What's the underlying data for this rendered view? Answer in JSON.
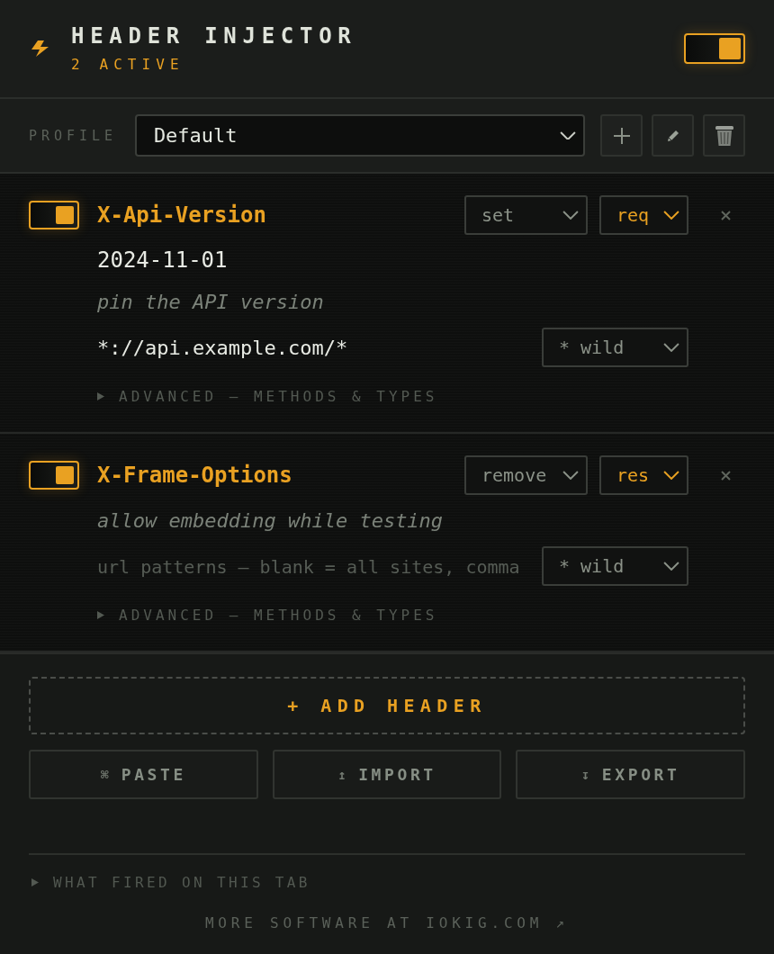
{
  "app": {
    "title": "HEADER INJECTOR",
    "status": "2 ACTIVE",
    "enabled": true
  },
  "profile": {
    "label": "PROFILE",
    "value": "Default"
  },
  "headers": [
    {
      "enabled": true,
      "name": "X-Api-Version",
      "operation": "set",
      "direction": "req",
      "value": "2024-11-01",
      "comment": "pin the API version",
      "url_patterns": {
        "value": "*://api.example.com/*"
      },
      "match_mode": "* wild",
      "advanced": {
        "label": "ADVANCED — METHODS & TYPES",
        "expanded": false
      }
    },
    {
      "enabled": true,
      "name": "X-Frame-Options",
      "operation": "remove",
      "direction": "res",
      "comment": "allow embedding while testing",
      "url_patterns": {
        "placeholder": "url patterns — blank = all sites, comma"
      },
      "match_mode": "* wild",
      "advanced": {
        "label": "ADVANCED — METHODS & TYPES",
        "expanded": false
      }
    }
  ],
  "add_button": "+ ADD HEADER",
  "actions": [
    {
      "icon": "⌘",
      "label": "PASTE"
    },
    {
      "icon": "↥",
      "label": "IMPORT"
    },
    {
      "icon": "↧",
      "label": "EXPORT"
    }
  ],
  "fired_log": {
    "label": "WHAT FIRED ON THIS TAB",
    "expanded": false
  },
  "footer_link": "MORE SOFTWARE AT IOKIG.COM ↗"
}
